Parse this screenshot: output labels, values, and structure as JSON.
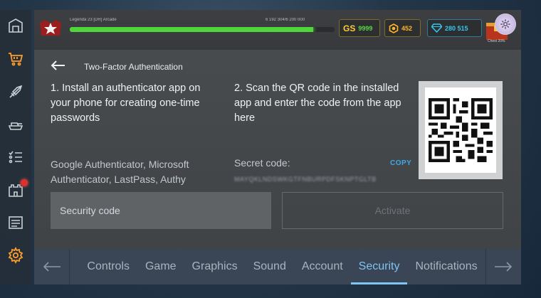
{
  "header": {
    "player_line": "Legenda 23 [DR] Arcade",
    "player_stats": "6 192 304/6 200 000",
    "xp_progress": 0.92,
    "gs_label": "GS",
    "gs_value": "9999",
    "gold_value": "452",
    "gems_value": "280 515",
    "chest_label": "Chest 20%"
  },
  "sidebar": {
    "items": [
      {
        "icon": "hangar-icon"
      },
      {
        "icon": "shop-cart-icon",
        "active": true
      },
      {
        "icon": "missile-icon"
      },
      {
        "icon": "tank-icon"
      },
      {
        "icon": "task-list-icon"
      },
      {
        "icon": "castle-icon",
        "notification": true
      },
      {
        "icon": "news-icon"
      },
      {
        "icon": "settings-gear-icon"
      }
    ]
  },
  "page": {
    "title": "Two-Factor Authentication",
    "step1": "1. Install an authenticator app on your phone for creating one-time passwords",
    "step2": "2. Scan the QR code in the installed app and enter the code from the app here",
    "apps": "Google Authenticator, Microsoft Authenticator, LastPass, Authy",
    "secret_label": "Secret code:",
    "copy_label": "COPY",
    "secret_value": "MAYQKLNDSWKGTFNBURPDFSKNPTGLTB",
    "input_placeholder": "Security code",
    "input_value": "",
    "activate_label": "Activate"
  },
  "tabs": [
    {
      "label": "Controls"
    },
    {
      "label": "Game"
    },
    {
      "label": "Graphics"
    },
    {
      "label": "Sound"
    },
    {
      "label": "Account"
    },
    {
      "label": "Security",
      "active": true
    },
    {
      "label": "Notifications"
    }
  ],
  "colors": {
    "accent_blue": "#7fc4f2",
    "copy_blue": "#3fa9e6",
    "active_orange": "#ff9d2b",
    "xp_green": "#4fd63a"
  }
}
